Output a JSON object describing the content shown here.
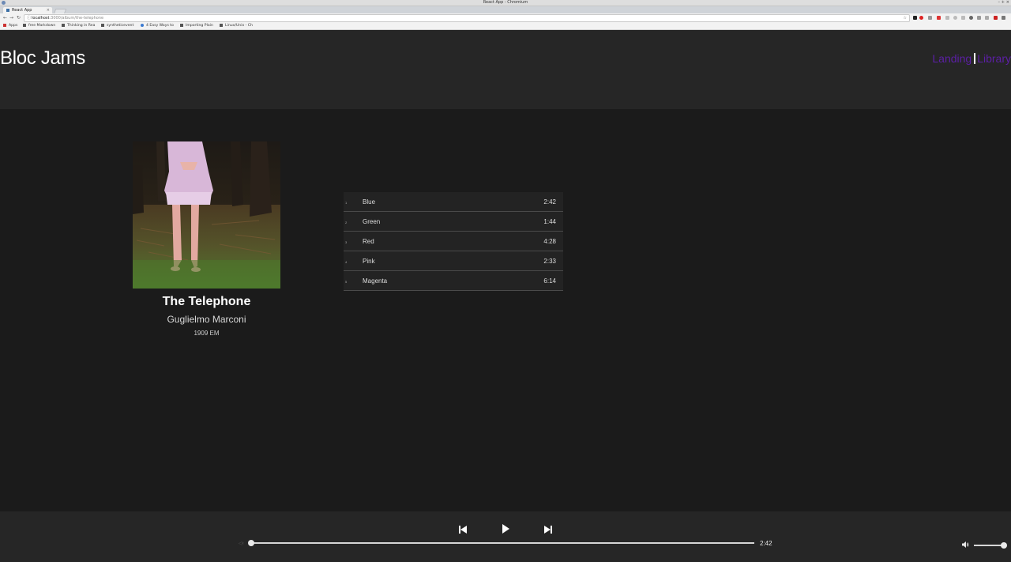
{
  "browser": {
    "window_title": "React App - Chromium",
    "tab_title": "React App",
    "url_host": "localhost",
    "url_rest": ":3000/album/the-telephone",
    "bookmarks": [
      {
        "label": "Apps"
      },
      {
        "label": "free Markdown"
      },
      {
        "label": "Thinking in Rea"
      },
      {
        "label": "syntheticevent"
      },
      {
        "label": "4 Easy Ways to"
      },
      {
        "label": "Importing Plain"
      },
      {
        "label": "Linux/Unix - Ch"
      }
    ]
  },
  "header": {
    "brand": "Bloc Jams",
    "nav": {
      "landing": "Landing",
      "library": "Library"
    }
  },
  "album": {
    "title": "The Telephone",
    "artist": "Guglielmo Marconi",
    "release": "1909 EM",
    "songs": [
      {
        "number": "1",
        "title": "Blue",
        "duration": "2:42"
      },
      {
        "number": "2",
        "title": "Green",
        "duration": "1:44"
      },
      {
        "number": "3",
        "title": "Red",
        "duration": "4:28"
      },
      {
        "number": "4",
        "title": "Pink",
        "duration": "2:33"
      },
      {
        "number": "5",
        "title": "Magenta",
        "duration": "6:14"
      }
    ]
  },
  "player": {
    "total_time": "2:42",
    "progress": 0.0,
    "volume": 1.0
  },
  "colors": {
    "nav_link": "#5c1fa6",
    "header_bg": "#262626",
    "page_bg": "#1b1b1b"
  }
}
